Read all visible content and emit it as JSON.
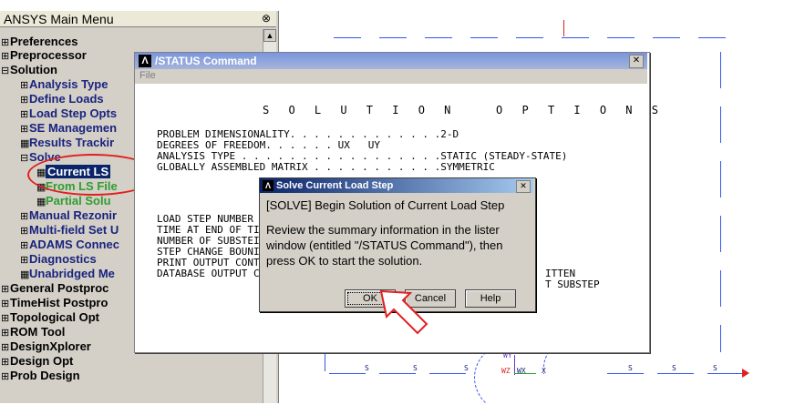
{
  "main_menu": {
    "title": "ANSYS Main Menu",
    "collapse_icon": "⊗",
    "items": [
      {
        "marker": "⊞",
        "label": "Preferences"
      },
      {
        "marker": "⊞",
        "label": "Preprocessor"
      },
      {
        "marker": "⊟",
        "label": "Solution"
      },
      {
        "marker": "⊞",
        "label": "Analysis Type"
      },
      {
        "marker": "⊞",
        "label": "Define Loads"
      },
      {
        "marker": "⊞",
        "label": "Load Step Opts"
      },
      {
        "marker": "⊞",
        "label": "SE Managemen"
      },
      {
        "marker": "▦",
        "label": "Results Trackir"
      },
      {
        "marker": "⊟",
        "label": "Solve"
      },
      {
        "marker": "▦",
        "label": "Current LS"
      },
      {
        "marker": "▦",
        "label": "From LS File"
      },
      {
        "marker": "▦",
        "label": "Partial Solu"
      },
      {
        "marker": "⊞",
        "label": "Manual Rezonir"
      },
      {
        "marker": "⊞",
        "label": "Multi-field Set U"
      },
      {
        "marker": "⊞",
        "label": "ADAMS Connec"
      },
      {
        "marker": "⊞",
        "label": "Diagnostics"
      },
      {
        "marker": "▦",
        "label": "Unabridged Me"
      },
      {
        "marker": "⊞",
        "label": "General Postproc"
      },
      {
        "marker": "⊞",
        "label": "TimeHist Postpro"
      },
      {
        "marker": "⊞",
        "label": "Topological Opt"
      },
      {
        "marker": "⊞",
        "label": "ROM Tool"
      },
      {
        "marker": "⊞",
        "label": "DesignXplorer"
      },
      {
        "marker": "⊞",
        "label": "Design Opt"
      },
      {
        "marker": "⊞",
        "label": "Prob Design"
      }
    ]
  },
  "status_window": {
    "title": "/STATUS Command",
    "menu_file": "File",
    "heading": "S O L U T I O N   O P T I O N S",
    "lines": [
      "PROBLEM DIMENSIONALITY. . . . . . . . . . . . .2-D",
      "DEGREES OF FREEDOM. . . . . . UX   UY",
      "ANALYSIS TYPE . . . . . . . . . . . . . . . . .STATIC (STEADY-STATE)",
      "GLOBALLY ASSEMBLED MATRIX . . . . . . . . . . .SYMMETRIC",
      "LOAD STEP NUMBER",
      "TIME AT END OF TI",
      "NUMBER OF SUBSTEI",
      "STEP CHANGE BOUNI",
      "PRINT OUTPUT CONT",
      "DATABASE OUTPUT C"
    ],
    "right_fragments": [
      "ITTEN",
      "T SUBSTEP"
    ]
  },
  "solve_dialog": {
    "title": "Solve Current Load Step",
    "heading": "[SOLVE] Begin Solution of Current Load Step",
    "message": "Review the summary information in the lister window (entitled \"/STATUS Command\"), then press OK to start the solution.",
    "ok_label": "OK",
    "cancel_label": "Cancel",
    "help_label": "Help"
  },
  "graphics": {
    "labels": [
      "S",
      "S",
      "S",
      "WY",
      "WZ",
      "WX",
      "X",
      "S",
      "S",
      "S"
    ]
  },
  "colors": {
    "highlight_red": "#e02020",
    "blue_item": "#1a237e",
    "green_item": "#2e9e2e"
  }
}
